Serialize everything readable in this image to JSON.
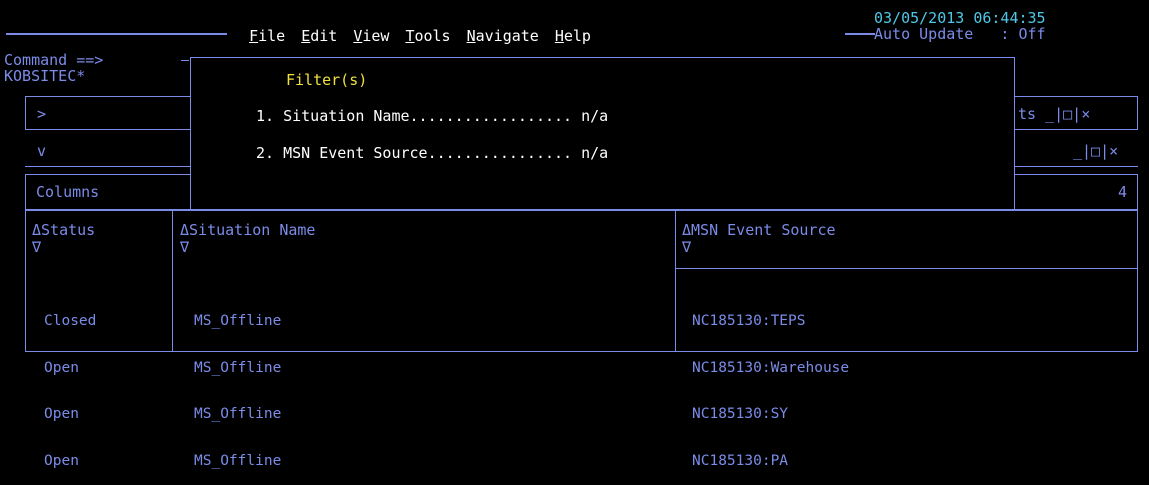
{
  "menu": {
    "items": [
      {
        "key": "F",
        "rest": "ile"
      },
      {
        "key": "E",
        "rest": "dit"
      },
      {
        "key": "V",
        "rest": "iew"
      },
      {
        "key": "T",
        "rest": "ools"
      },
      {
        "key": "N",
        "rest": "avigate"
      },
      {
        "key": "H",
        "rest": "elp"
      }
    ]
  },
  "header": {
    "datetime": "03/05/2013 06:44:35",
    "auto_update": "Auto Update   : Off",
    "command_label": "Command ==>",
    "system_name": "KOBSITEC*"
  },
  "side_panels": {
    "expand_arrow": ">",
    "collapse_arrow": "v",
    "columns_label": "Columns",
    "right_title_fragment": "ts _|□|×",
    "right_controls": "_|□|×",
    "count": "4"
  },
  "popup": {
    "title": "Filter(s)",
    "filters": [
      {
        "num": "1.",
        "label": "Situation Name..................",
        "value": "n/a"
      },
      {
        "num": "2.",
        "label": "MSN Event Source................",
        "value": "n/a"
      }
    ]
  },
  "table": {
    "headers": [
      "ΔStatus",
      "ΔSituation Name",
      "ΔMSN Event Source"
    ],
    "sort_down": "∇",
    "rows": [
      {
        "status": "Closed",
        "situation": "MS_Offline",
        "source": "NC185130:TEPS"
      },
      {
        "status": "Open",
        "situation": "MS_Offline",
        "source": "NC185130:Warehouse"
      },
      {
        "status": "Open",
        "situation": "MS_Offline",
        "source": "NC185130:SY"
      },
      {
        "status": "Open",
        "situation": "MS_Offline",
        "source": "NC185130:PA"
      }
    ]
  },
  "colors": {
    "background": "#000000",
    "border": "#7b8ce8",
    "menu_text": "#ffffff",
    "datetime": "#4fc8e8",
    "popup_title": "#f0e040"
  }
}
